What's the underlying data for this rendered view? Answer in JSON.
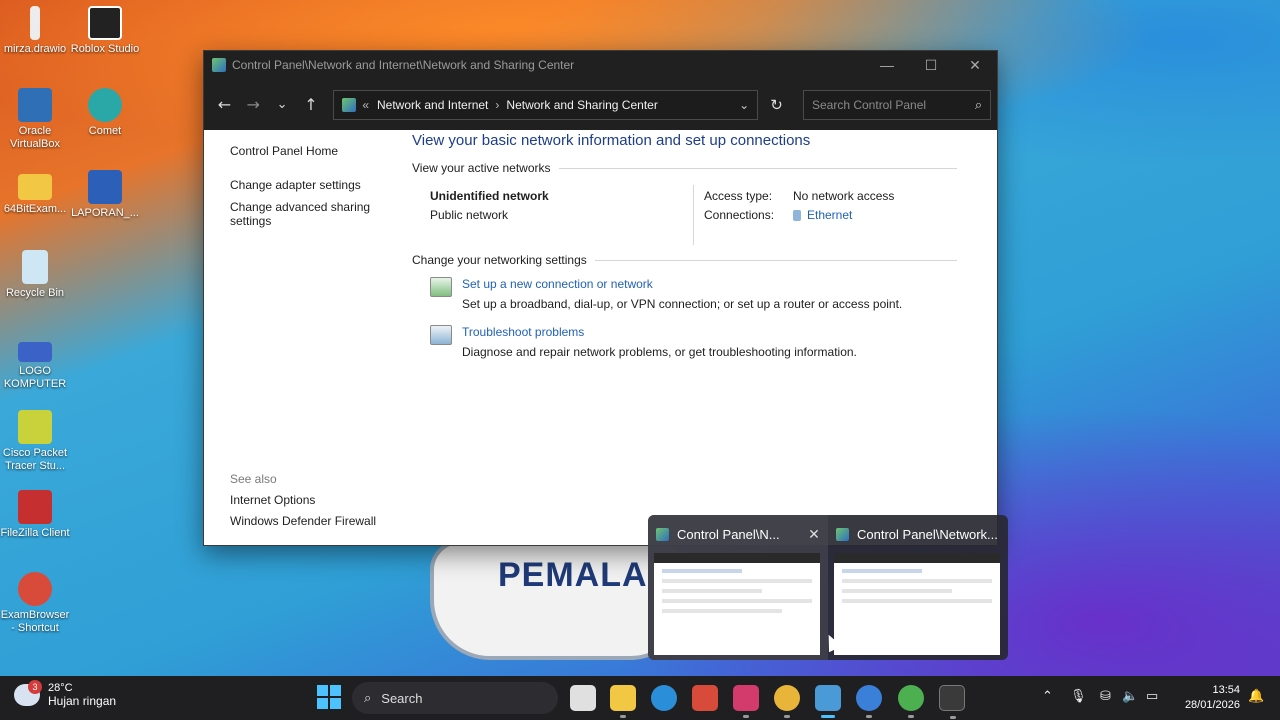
{
  "desktop_icons": [
    {
      "label": "mirza.drawio",
      "color": "#e8e8e8"
    },
    {
      "label": "Roblox Studio",
      "color": "#222222"
    },
    {
      "label": "Oracle VirtualBox",
      "color": "#2f6fb5"
    },
    {
      "label": "Comet",
      "color": "#2aa8a8"
    },
    {
      "label": "64BitExam...",
      "color": "#f2c744"
    },
    {
      "label": "LAPORAN_...",
      "color": "#2b5fb8"
    },
    {
      "label": "Recycle Bin",
      "color": "#cfe6f5"
    },
    {
      "label": "LOGO KOMPUTER",
      "color": "#3b62c7"
    },
    {
      "label": "Cisco Packet Tracer Stu...",
      "color": "#c9d23a"
    },
    {
      "label": "FileZilla Client",
      "color": "#c62f2f"
    },
    {
      "label": "ExamBrowser - Shortcut",
      "color": "#d84b3b"
    }
  ],
  "wallpaper_text": "PEMALA",
  "window": {
    "title": "Control Panel\\Network and Internet\\Network and Sharing Center",
    "controls": {
      "minimize": "—",
      "maximize": "☐",
      "close": "✕"
    },
    "nav": {
      "back": "←",
      "forward": "→",
      "recent": "⌄",
      "up": "↑"
    },
    "address": {
      "prefix": "«",
      "crumb1": "Network and Internet",
      "separator": "›",
      "crumb2": "Network and Sharing Center",
      "dropdown": "⌄",
      "refresh": "↻"
    },
    "search": {
      "placeholder": "Search Control Panel",
      "icon": "⌕"
    },
    "left": {
      "home": "Control Panel Home",
      "links": [
        "Change adapter settings",
        "Change advanced sharing settings"
      ],
      "see_also_header": "See also",
      "see_also": [
        "Internet Options",
        "Windows Defender Firewall"
      ]
    },
    "main": {
      "heading": "View your basic network information and set up connections",
      "active_header": "View your active networks",
      "network_name": "Unidentified network",
      "network_type": "Public network",
      "access_type_label": "Access type:",
      "access_type_value": "No network access",
      "connections_label": "Connections:",
      "connections_value": "Ethernet",
      "settings_header": "Change your networking settings",
      "tasks": [
        {
          "link": "Set up a new connection or network",
          "desc": "Set up a broadband, dial-up, or VPN connection; or set up a router or access point."
        },
        {
          "link": "Troubleshoot problems",
          "desc": "Diagnose and repair network problems, or get troubleshooting information."
        }
      ]
    }
  },
  "previews": [
    {
      "title": "Control Panel\\N...",
      "close": "✕"
    },
    {
      "title": "Control Panel\\Network..."
    }
  ],
  "taskbar": {
    "weather_badge": "3",
    "temperature": "28°C",
    "condition": "Hujan ringan",
    "search_label": "Search",
    "search_icon": "⌕",
    "tray_icons": {
      "chevron": "⌃",
      "mic": "🎙",
      "network": "⛁",
      "volume": "🔈",
      "battery": "▭",
      "notify": "🔔"
    },
    "time": "13:54",
    "date": "28/01/2026",
    "apps": [
      {
        "name": "task-view",
        "color": "#e0e0e0"
      },
      {
        "name": "file-explorer",
        "color": "#f2c744"
      },
      {
        "name": "edge",
        "color": "#2a8fd8"
      },
      {
        "name": "exambrowser",
        "color": "#d84b3b"
      },
      {
        "name": "snipping",
        "color": "#d23b6b"
      },
      {
        "name": "chrome",
        "color": "#e8b43a"
      },
      {
        "name": "control-panel",
        "color": "#4a9ad8"
      },
      {
        "name": "comet",
        "color": "#3a7fd8"
      },
      {
        "name": "chrome-profile",
        "color": "#4caf50"
      },
      {
        "name": "terminal",
        "color": "#3a3a3a"
      }
    ]
  }
}
